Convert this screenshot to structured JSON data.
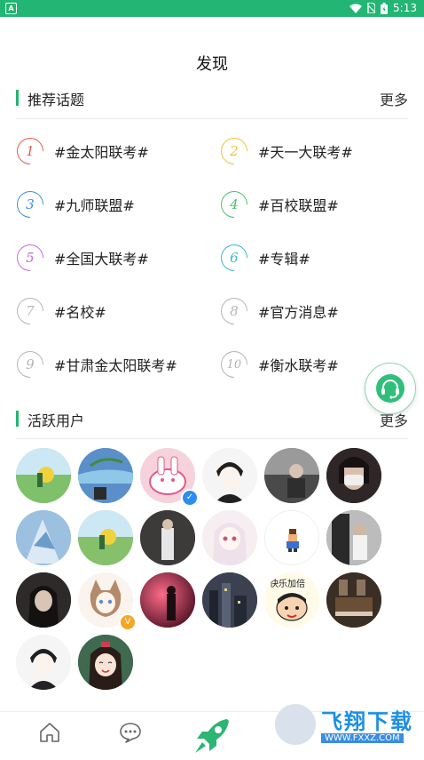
{
  "status_bar": {
    "time": "5:13",
    "app_icon": "A"
  },
  "page_title": "发现",
  "topics_section": {
    "title": "推荐话题",
    "more": "更多"
  },
  "topics": [
    {
      "rank": "1",
      "label": "#金太阳联考#",
      "color": "#e25b4f"
    },
    {
      "rank": "2",
      "label": "#天一大联考#",
      "color": "#f1c232"
    },
    {
      "rank": "3",
      "label": "#九师联盟#",
      "color": "#3f8fd8"
    },
    {
      "rank": "4",
      "label": "#百校联盟#",
      "color": "#4cbf6a"
    },
    {
      "rank": "5",
      "label": "#全国大联考#",
      "color": "#c46bd6"
    },
    {
      "rank": "6",
      "label": "#专辑#",
      "color": "#3ab6c8"
    },
    {
      "rank": "7",
      "label": "#名校#",
      "color": "#b5b5b5"
    },
    {
      "rank": "8",
      "label": "#官方消息#",
      "color": "#b5b5b5"
    },
    {
      "rank": "9",
      "label": "#甘肃金太阳联考#",
      "color": "#b5b5b5"
    },
    {
      "rank": "10",
      "label": "#衡水联考#",
      "color": "#b5b5b5"
    }
  ],
  "users_section": {
    "title": "活跃用户",
    "more": "更多"
  },
  "avatars": [
    {
      "icon": "avatar-anime-field",
      "bg": "#7fc06b",
      "badge": ""
    },
    {
      "icon": "avatar-sky",
      "bg": "#5b8fc9",
      "badge": ""
    },
    {
      "icon": "avatar-pink-rabbit",
      "bg": "#f6d3dc",
      "badge": "✓",
      "badge_color": "blue"
    },
    {
      "icon": "avatar-anime-boy",
      "bg": "#f2f2f2",
      "badge": ""
    },
    {
      "icon": "avatar-photo-people",
      "bg": "#6e6e6e",
      "badge": ""
    },
    {
      "icon": "avatar-mask-girl",
      "bg": "#3b3131",
      "badge": ""
    },
    {
      "icon": "avatar-ice-scene",
      "bg": "#8fb4d9",
      "badge": ""
    },
    {
      "icon": "avatar-anime-field",
      "bg": "#86c06b",
      "badge": ""
    },
    {
      "icon": "avatar-dark-room",
      "bg": "#3d3a3a",
      "badge": ""
    },
    {
      "icon": "avatar-anime-girl",
      "bg": "#f3e6ea",
      "badge": ""
    },
    {
      "icon": "avatar-pixel-character",
      "bg": "#ffffff",
      "badge": ""
    },
    {
      "icon": "avatar-doorway",
      "bg": "#4c4c4c",
      "badge": ""
    },
    {
      "icon": "avatar-dark-girl",
      "bg": "#2e2a2a",
      "badge": ""
    },
    {
      "icon": "avatar-anime-cat-girl",
      "bg": "#f7eee7",
      "badge": "V",
      "badge_color": "orange"
    },
    {
      "icon": "avatar-red-light",
      "bg": "#b0294a",
      "badge": ""
    },
    {
      "icon": "avatar-city-night",
      "bg": "#3b4150",
      "badge": ""
    },
    {
      "icon": "avatar-crayon-shinchan",
      "bg": "#fff3c7",
      "badge": ""
    },
    {
      "icon": "avatar-piano-room",
      "bg": "#4a3b2f",
      "badge": ""
    },
    {
      "icon": "avatar-anime-boy",
      "bg": "#f2f2f2",
      "badge": ""
    },
    {
      "icon": "avatar-anime-smile-girl",
      "bg": "#2f4d3d",
      "badge": ""
    }
  ],
  "avatar_text_crayon": "快乐加倍",
  "tabbar": {
    "items": [
      {
        "icon": "home-icon"
      },
      {
        "icon": "message-icon"
      },
      {
        "icon": "rocket-icon"
      }
    ]
  },
  "support_button": {
    "icon": "headset-icon"
  },
  "watermark": {
    "title": "飞翔下载",
    "url": "WWW.FXXZ.COM"
  }
}
